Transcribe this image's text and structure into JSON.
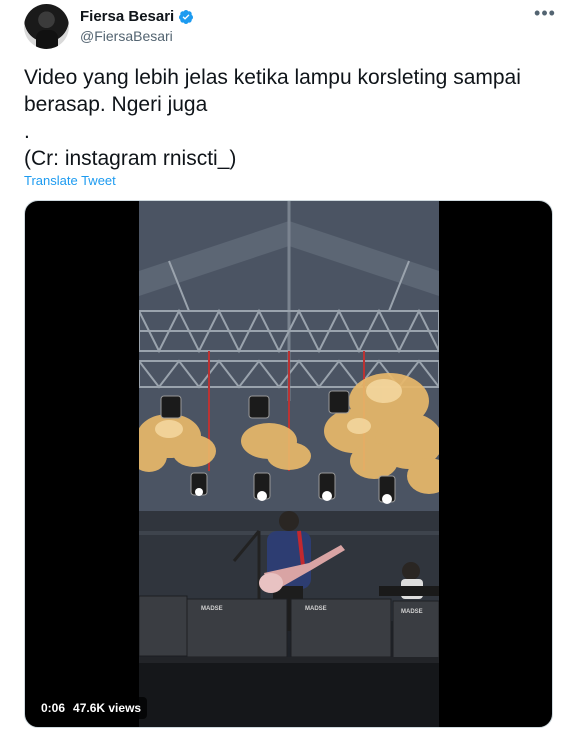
{
  "author": {
    "name": "Fiersa Besari",
    "handle": "@FiersaBesari",
    "verified_icon": "verified-badge",
    "verified_color": "#1d9bf0"
  },
  "tweet": {
    "text": "Video yang lebih jelas ketika lampu korsleting sampai berasap. Ngeri juga\n.\n(Cr: instagram rniscti_)",
    "translate_label": "Translate Tweet"
  },
  "media": {
    "duration": "0:06",
    "views": "47.6K views",
    "speaker_label": "MADSE"
  },
  "menu": {
    "more_icon": "more-horizontal-icon"
  },
  "colors": {
    "link": "#1d9bf0",
    "secondary_text": "#536471",
    "smoke": "#e8b86a"
  }
}
